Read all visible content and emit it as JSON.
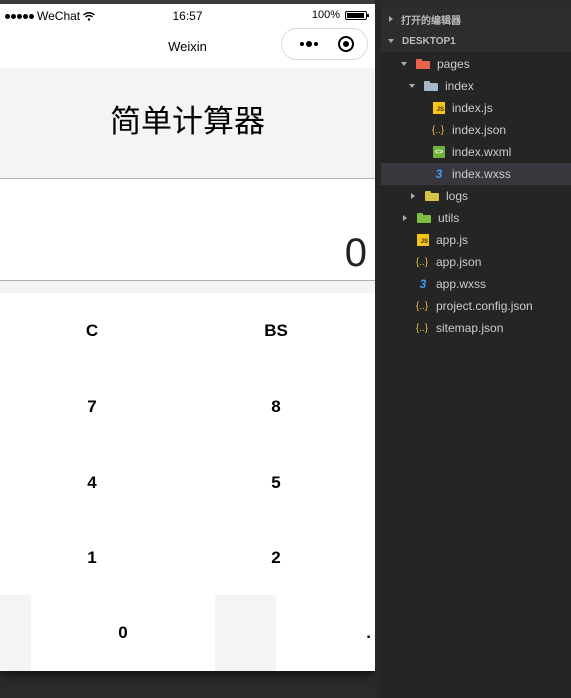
{
  "simulator": {
    "status_bar": {
      "carrier": "WeChat",
      "time": "16:57",
      "battery": "100%"
    },
    "nav": {
      "title": "Weixin",
      "more_icon": "more-dots-icon",
      "close_icon": "capsule-close-icon"
    },
    "page": {
      "title": "简单计算器",
      "display_value": "0",
      "keys": [
        "C",
        "BS",
        "7",
        "8",
        "4",
        "5",
        "1",
        "2",
        "0",
        "."
      ]
    }
  },
  "explorer": {
    "open_editors_label": "打开的编辑器",
    "project_label": "DESKTOP1",
    "items": [
      {
        "label": "pages",
        "type": "folder",
        "icon": "folder-pages-icon"
      },
      {
        "label": "index",
        "type": "folder",
        "icon": "folder-open-icon"
      },
      {
        "label": "index.js",
        "type": "js",
        "icon": "js-file-icon"
      },
      {
        "label": "index.json",
        "type": "json",
        "icon": "json-file-icon"
      },
      {
        "label": "index.wxml",
        "type": "wxml",
        "icon": "wxml-file-icon"
      },
      {
        "label": "index.wxss",
        "type": "wxss",
        "icon": "wxss-file-icon",
        "selected": true
      },
      {
        "label": "logs",
        "type": "folder",
        "icon": "folder-icon"
      },
      {
        "label": "utils",
        "type": "folder",
        "icon": "folder-icon"
      },
      {
        "label": "app.js",
        "type": "js",
        "icon": "js-file-icon"
      },
      {
        "label": "app.json",
        "type": "json",
        "icon": "json-file-icon"
      },
      {
        "label": "app.wxss",
        "type": "wxss",
        "icon": "wxss-file-icon"
      },
      {
        "label": "project.config.json",
        "type": "json",
        "icon": "json-file-icon"
      },
      {
        "label": "sitemap.json",
        "type": "json",
        "icon": "json-file-icon"
      }
    ]
  }
}
